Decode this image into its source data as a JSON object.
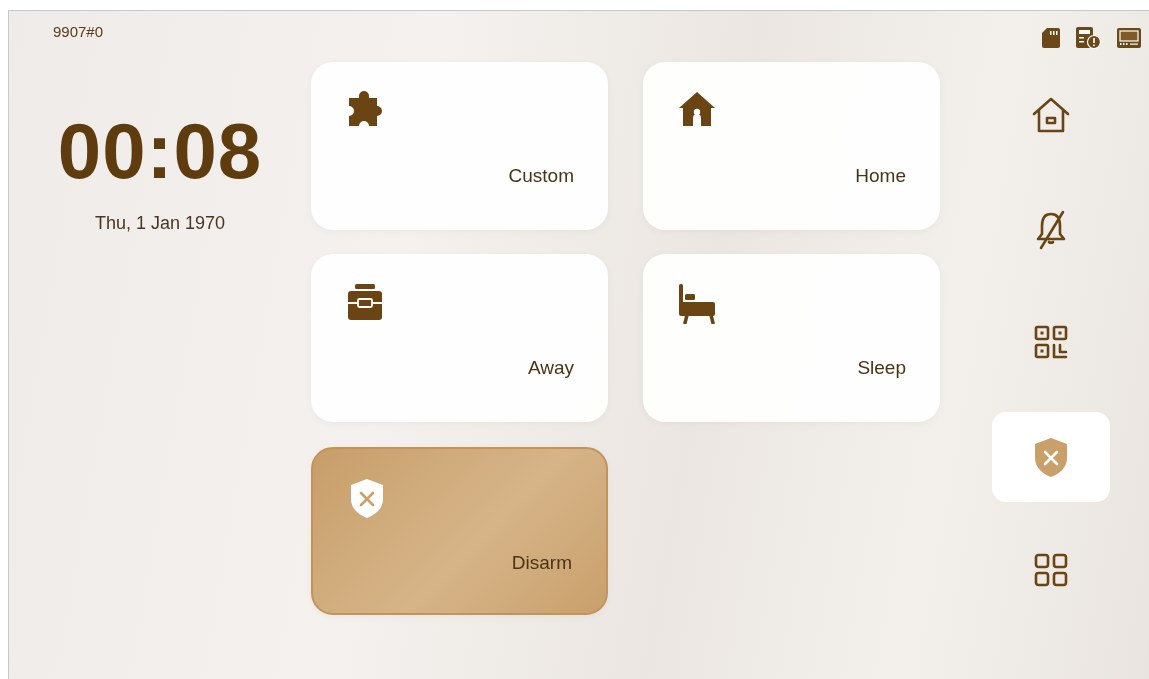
{
  "device_id": "9907#0",
  "clock": {
    "time": "00:08",
    "date": "Thu, 1 Jan 1970"
  },
  "modes": [
    {
      "kind": "custom",
      "label": "Custom",
      "selected": false
    },
    {
      "kind": "home",
      "label": "Home",
      "selected": false
    },
    {
      "kind": "away",
      "label": "Away",
      "selected": false
    },
    {
      "kind": "sleep",
      "label": "Sleep",
      "selected": false
    },
    {
      "kind": "disarm",
      "label": "Disarm",
      "selected": true
    }
  ],
  "nav": [
    {
      "kind": "home",
      "selected": false
    },
    {
      "kind": "bell-off",
      "selected": false
    },
    {
      "kind": "qr",
      "selected": false
    },
    {
      "kind": "shield",
      "selected": true
    },
    {
      "kind": "apps",
      "selected": false
    }
  ]
}
